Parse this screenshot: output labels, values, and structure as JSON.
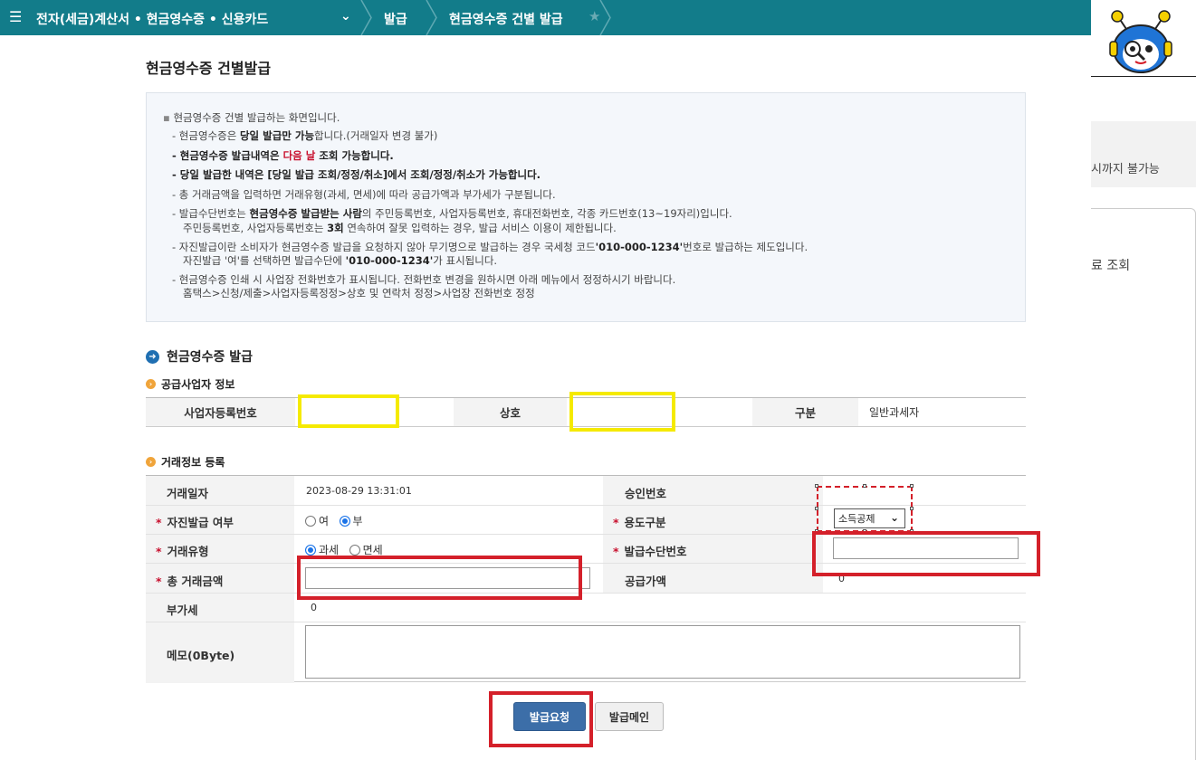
{
  "topbar": {
    "menu_title": "전자(세금)계산서 • 현금영수증 • 신용카드",
    "crumb_issue": "발급",
    "crumb_current": "현금영수증 건별 발급"
  },
  "right_panel": {
    "text1": "시까지 불가능",
    "text2": "료 조회"
  },
  "page": {
    "title": "현금영수증 건별발급"
  },
  "info": {
    "head": "현금영수증 건별 발급하는 화면입니다.",
    "l1_a": "- 현금영수증은 ",
    "l1_b": "당일 발급만 가능",
    "l1_c": "합니다.(거래일자 변경 불가)",
    "l2_a": "- 현금영수증 발급내역은 ",
    "l2_b": "다음 날",
    "l2_c": " 조회 가능합니다.",
    "l3": "- 당일 발급한 내역은 [당일 발급 조회/정정/취소]에서 조회/정정/취소가 가능합니다.",
    "l4": "- 총 거래금액을 입력하면 거래유형(과세, 면세)에 따라 공급가액과 부가세가 구분됩니다.",
    "l5_a": "- 발급수단번호는 ",
    "l5_b": "현금영수증 발급받는 사람",
    "l5_c": "의  주민등록번호, 사업자등록번호, 휴대전화번호, 각종 카드번호(13~19자리)입니다.",
    "l5_d": "주민등록번호, 사업자등록번호는 ",
    "l5_e": "3회",
    "l5_f": " 연속하여 잘못 입력하는 경우, 발급 서비스 이용이 제한됩니다.",
    "l6_a": "- 자진발급이란 소비자가 현금영수증 발급을 요청하지 않아 무기명으로 발급하는 경우 국세청 코드",
    "l6_b": "'010-000-1234'",
    "l6_c": "번호로 발급하는 제도입니다.",
    "l6_d": "자진발급 '여'를 선택하면 발급수단에 ",
    "l6_e": "'010-000-1234'",
    "l6_f": "가 표시됩니다.",
    "l7_a": "- 현금영수증 인쇄 시 사업장 전화번호가 표시됩니다. 전화번호 변경을 원하시면 아래 메뉴에서 정정하시기 바랍니다.",
    "l7_b": "홈택스>신청/제출>사업자등록정정>상호 및 연락처 정정>사업장 전화번호 정정"
  },
  "section": {
    "title": "현금영수증 발급",
    "supplier_title": "공급사업자 정보",
    "tx_title": "거래정보 등록"
  },
  "supplier": {
    "bizno_label": "사업자등록번호",
    "name_label": "상호",
    "type_label": "구분",
    "type_value": "일반과세자"
  },
  "tx": {
    "date_label": "거래일자",
    "date_value": "2023-08-29 13:31:01",
    "approval_label": "승인번호",
    "self_label": "자진발급 여부",
    "self_yes": "여",
    "self_no": "부",
    "usage_label": "용도구분",
    "usage_value": "소득공제",
    "type_label": "거래유형",
    "type_tax": "과세",
    "type_free": "면세",
    "means_label": "발급수단번호",
    "total_label": "총 거래금액",
    "supply_label": "공급가액",
    "supply_value": "0",
    "vat_label": "부가세",
    "vat_value": "0",
    "memo_label": "메모(0Byte)",
    "required_mark": "*"
  },
  "buttons": {
    "issue_request": "발급요청",
    "issue_main": "발급메인"
  }
}
